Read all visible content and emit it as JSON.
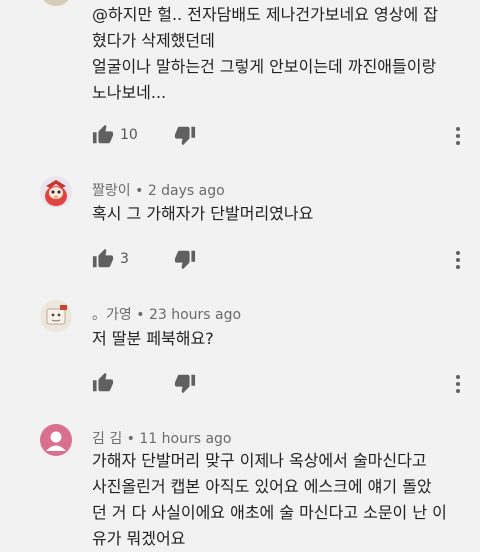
{
  "comments": [
    {
      "author": "",
      "time": "",
      "lines": [
        "@하지만 헐.. 전자담배도 제나건가보네요 영상에 잡",
        "혔다가 삭제했던데",
        "얼굴이나 말하는건 그렇게 안보이는데 까진애들이랑",
        "노나보네..."
      ],
      "likes": "10"
    },
    {
      "author": "짤랑이",
      "separator": "•",
      "time": "2 days ago",
      "lines": [
        "혹시 그 가해자가 단발머리였나요"
      ],
      "likes": "3"
    },
    {
      "author": "。가영",
      "separator": "•",
      "time": "23 hours ago",
      "lines": [
        "저 딸분 페북해요?"
      ],
      "likes": ""
    },
    {
      "author": "김 김",
      "separator": "•",
      "time": "11 hours ago",
      "lines": [
        "가해자 단발머리 맞구 이제나 옥상에서 술마신다고",
        "사진올린거 캡본 아직도 있어요 에스크에 얘기 돌았",
        "던 거 다 사실이에요 애초에 술 마신다고 소문이 난 이",
        "유가 뭐겠어요"
      ],
      "likes": ""
    }
  ],
  "colors": {
    "background": "#f2f2f2",
    "meta_text": "#6b6b6b",
    "icon": "#606060",
    "pink_avatar": "#d9708f"
  },
  "icons": [
    "like-icon",
    "dislike-icon",
    "more-vert-icon",
    "default-avatar-icon"
  ]
}
